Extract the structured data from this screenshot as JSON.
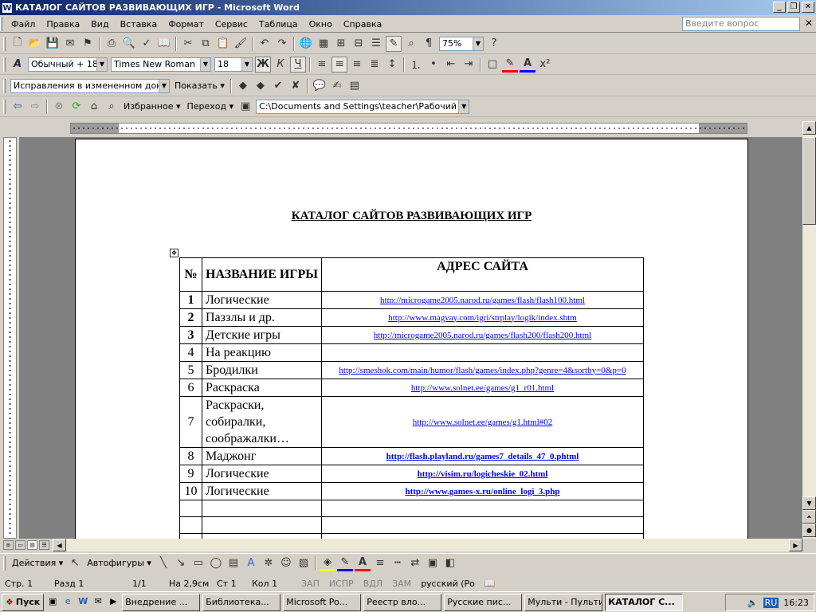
{
  "window": {
    "title": "КАТАЛОГ САЙТОВ РАЗВИВАЮЩИХ ИГР - Microsoft Word"
  },
  "menu": {
    "items": [
      "Файл",
      "Правка",
      "Вид",
      "Вставка",
      "Формат",
      "Сервис",
      "Таблица",
      "Окно",
      "Справка"
    ],
    "question_placeholder": "Введите вопрос"
  },
  "standard": {
    "zoom": "75%"
  },
  "formatting": {
    "style": "Обычный + 18 р",
    "font": "Times New Roman",
    "size": "18",
    "bold": "Ж",
    "italic": "К",
    "underline": "Ч"
  },
  "reviewing": {
    "mode": "Исправления в измененном документ",
    "show": "Показать"
  },
  "web": {
    "favorites": "Избранное",
    "go": "Переход",
    "address": "C:\\Documents and Settings\\teacher\\Рабочий стол\\"
  },
  "document": {
    "title": "КАТАЛОГ САЙТОВ РАЗВИВАЮЩИХ ИГР",
    "headers": {
      "num": "№",
      "name": "НАЗВАНИЕ ИГРЫ",
      "address": "АДРЕС САЙТА"
    },
    "rows": [
      {
        "num": "1",
        "name": "Логические",
        "url": "http://microgame2005.narod.ru/games/flash/flash100.html",
        "bold": false
      },
      {
        "num": "2",
        "name": "Паззлы и др.",
        "url": "http://www.magvay.com/igri/strplay/logik/index.shtm",
        "bold": false
      },
      {
        "num": "3",
        "name": "Детские игры",
        "url": "http://microgame2005.narod.ru/games/flash200/flash200.html",
        "bold": false
      },
      {
        "num": "4",
        "name": "На реакцию",
        "url": "",
        "bold": false
      },
      {
        "num": "5",
        "name": "Бродилки",
        "url": "http://smeshok.com/main/humor/flash/games/index.php?genre=4&sortby=0&p=0",
        "bold": false
      },
      {
        "num": "6",
        "name": "Раскраска",
        "url": "http://www.solnet.ee/games/g1_r01.html",
        "bold": false
      },
      {
        "num": "7",
        "name": "Раскраски, собиралки, соображалки…",
        "url": "http://www.solnet.ee/games/g1.html#02",
        "bold": false
      },
      {
        "num": "8",
        "name": "Маджонг",
        "url": "http://flash.playland.ru/games7_details_47_0.phtml",
        "bold": true
      },
      {
        "num": "9",
        "name": "Логические",
        "url": "http://visim.ru/logicheskie_02.html",
        "bold": true
      },
      {
        "num": "10",
        "name": "Логические",
        "url": "http://www.games-x.ru/online_logi_3.php",
        "bold": true
      }
    ]
  },
  "drawing": {
    "actions": "Действия",
    "autoshapes": "Автофигуры"
  },
  "status": {
    "page": "Стр. 1",
    "section": "Разд 1",
    "pages": "1/1",
    "at": "На 2,9см",
    "line": "Ст 1",
    "col": "Кол 1",
    "rec": "ЗАП",
    "trk": "ИСПР",
    "ext": "ВДЛ",
    "ovr": "ЗАМ",
    "lang": "русский (Ро"
  },
  "taskbar": {
    "start": "Пуск",
    "tasks": [
      "Внедрение ...",
      "Библиотека...",
      "Microsoft Po...",
      "Реестр вло...",
      "Русские пис...",
      "Мульти - Пульти",
      "КАТАЛОГ С..."
    ],
    "lang": "RU",
    "time": "16:23"
  },
  "colors": {
    "titlebar": "#0a246a",
    "link": "#0000ff"
  }
}
